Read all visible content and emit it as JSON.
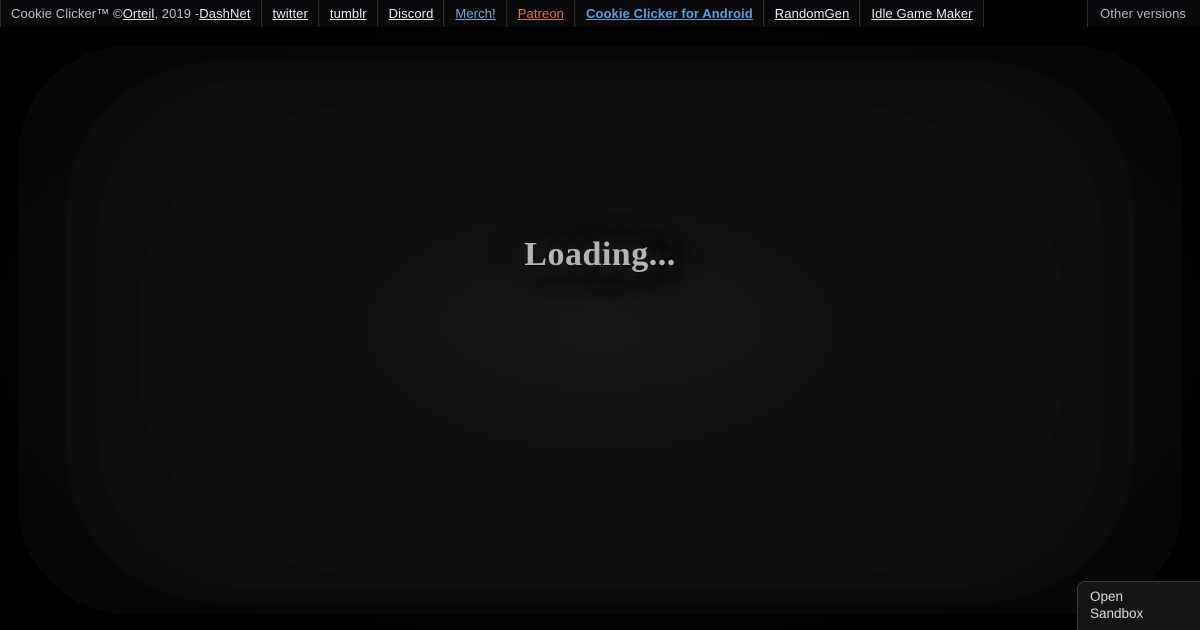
{
  "topbar": {
    "credit": {
      "prefix": "Cookie Clicker™ © ",
      "author": "Orteil",
      "middle": ", 2019 - ",
      "studio": "DashNet"
    },
    "links": [
      {
        "label": "twitter",
        "style": "default"
      },
      {
        "label": "tumblr",
        "style": "default"
      },
      {
        "label": "Discord",
        "style": "default"
      },
      {
        "label": "Merch!",
        "style": "merch"
      },
      {
        "label": "Patreon",
        "style": "patreon"
      },
      {
        "label": "Cookie Clicker for Android",
        "style": "android"
      },
      {
        "label": "RandomGen",
        "style": "default"
      },
      {
        "label": "Idle Game Maker",
        "style": "default"
      }
    ],
    "other_versions_label": "Other versions"
  },
  "game": {
    "loading_text": "Loading..."
  },
  "sandbox": {
    "line1": "Open",
    "line2": "Sandbox"
  },
  "colors": {
    "page_background": "#000000",
    "topbar_background": "#09090b",
    "topbar_border": "#2b2b2b",
    "link_default": "#e7ecf0",
    "link_merch": "#7aa7d6",
    "link_patreon": "#e06e5b",
    "link_android": "#57a0db",
    "other_versions_text": "#aeb5bb",
    "loading_text": "#b4b4b4",
    "sandbox_background": "#141414",
    "sandbox_border": "#3a3d40",
    "sandbox_text": "#d6dbe0"
  }
}
